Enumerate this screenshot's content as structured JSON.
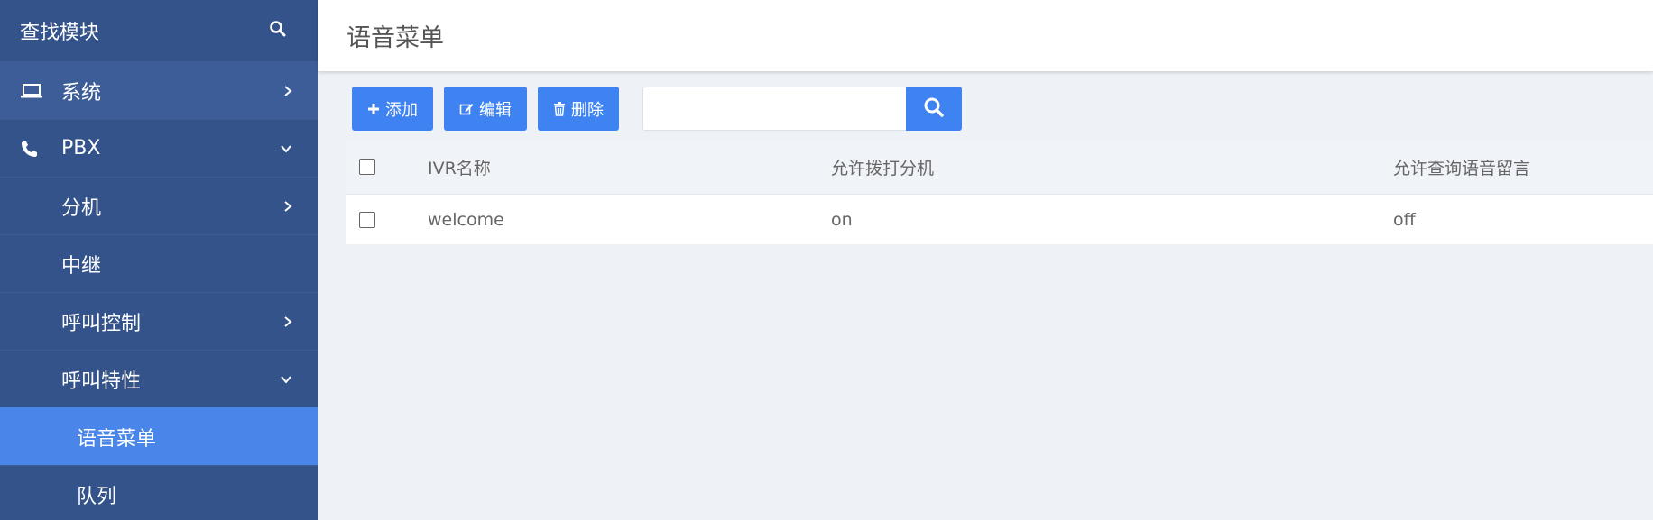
{
  "sidebar": {
    "search_title": "查找模块",
    "items": [
      {
        "label": "系统",
        "icon": "laptop-icon",
        "chevron": "right"
      },
      {
        "label": "PBX",
        "icon": "phone-icon",
        "chevron": "down"
      },
      {
        "label": "分机",
        "chevron": "right"
      },
      {
        "label": "中继"
      },
      {
        "label": "呼叫控制",
        "chevron": "right"
      },
      {
        "label": "呼叫特性",
        "chevron": "down"
      },
      {
        "label": "语音菜单"
      },
      {
        "label": "队列"
      }
    ]
  },
  "header": {
    "title": "语音菜单"
  },
  "toolbar": {
    "add_label": "添加",
    "edit_label": "编辑",
    "delete_label": "删除",
    "search_value": ""
  },
  "table": {
    "columns": [
      "IVR名称",
      "允许拨打分机",
      "允许查询语音留言"
    ],
    "rows": [
      {
        "name": "welcome",
        "dial_ext": "on",
        "voicemail": "off"
      }
    ]
  },
  "colors": {
    "sidebar_bg": "#34538b",
    "active_bg": "#4a85ea",
    "button_bg": "#3f83f2"
  }
}
